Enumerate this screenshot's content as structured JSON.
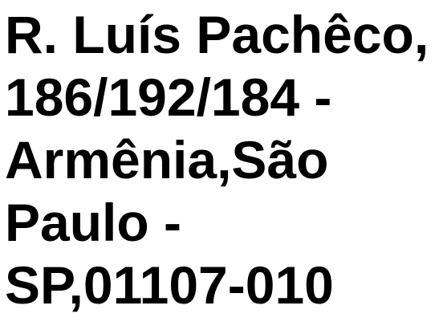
{
  "address": {
    "lines": [
      "R. Luís Pachêco,",
      "186/192/184 -",
      "Armênia,São",
      "Paulo -",
      "SP,01107-010"
    ]
  },
  "colors": {
    "text": "#000000",
    "background": "#ffffff"
  }
}
